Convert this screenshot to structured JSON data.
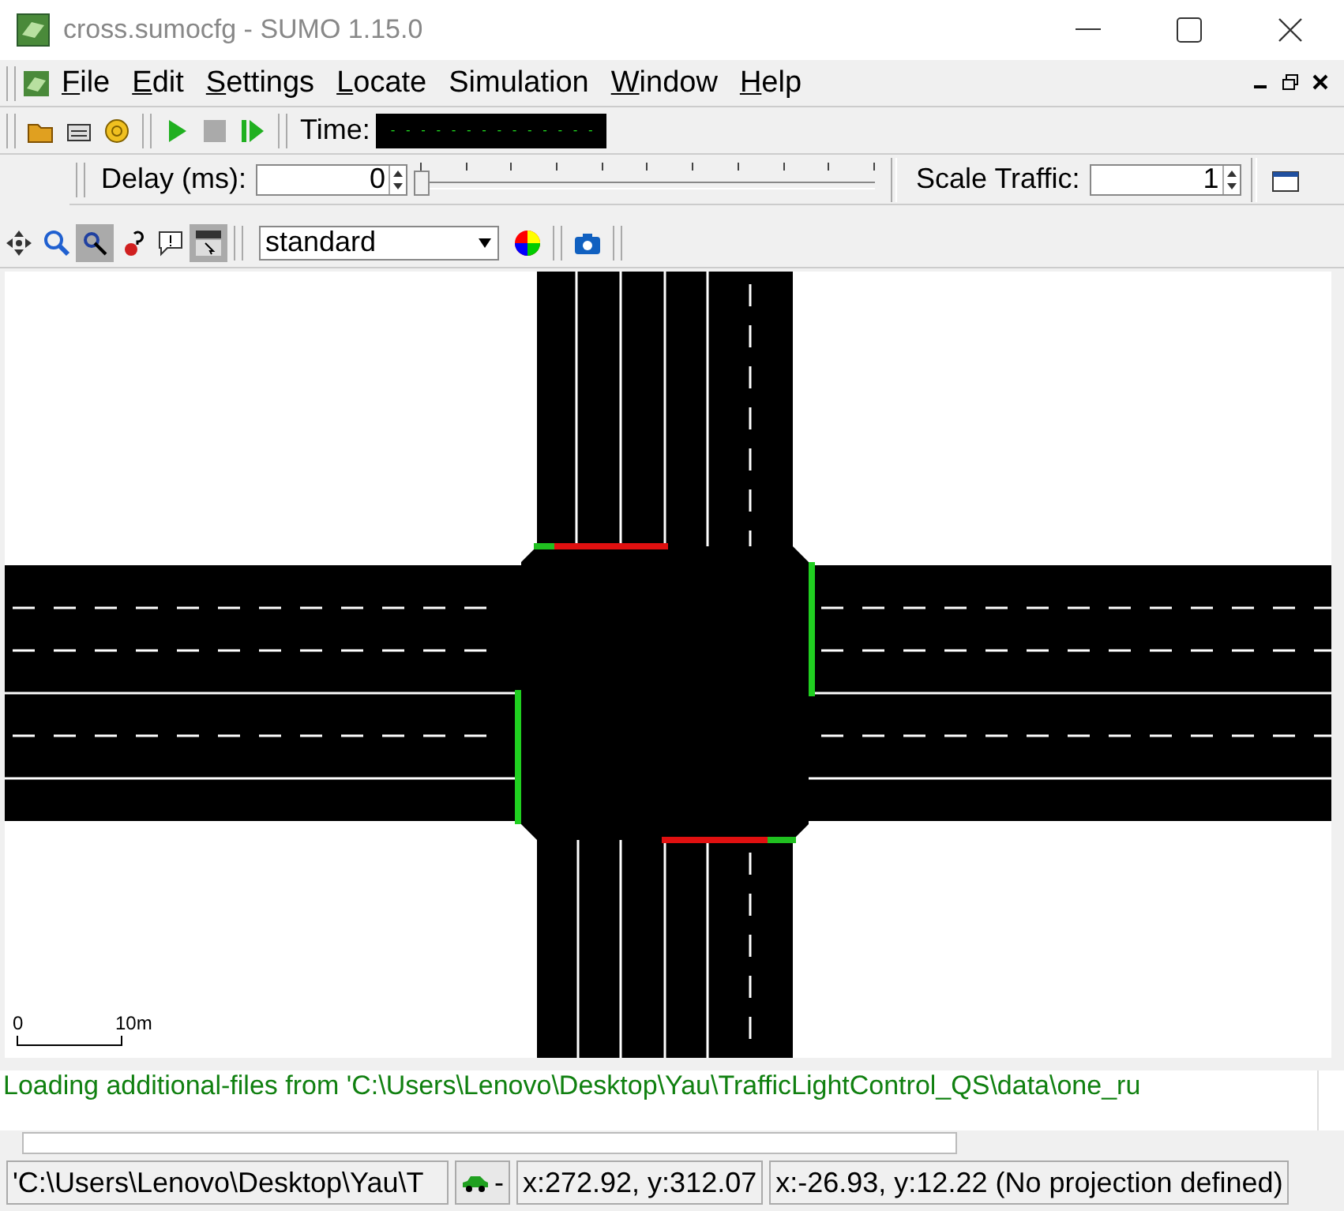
{
  "window": {
    "title": "cross.sumocfg - SUMO 1.15.0"
  },
  "menu": [
    {
      "label": "File",
      "underline_first": true
    },
    {
      "label": "Edit",
      "underline_first": true
    },
    {
      "label": "Settings",
      "underline_first": true
    },
    {
      "label": "Locate",
      "underline_first": true
    },
    {
      "label": "Simulation",
      "underline_first": false
    },
    {
      "label": "Window",
      "underline_first": true
    },
    {
      "label": "Help",
      "underline_first": true
    }
  ],
  "toolbar": {
    "time_label": "Time:",
    "time_display": "- - - - - - - - - - - - - -"
  },
  "delay": {
    "label": "Delay (ms):",
    "value": "0",
    "level": 0
  },
  "scale_traffic": {
    "label": "Scale Traffic:",
    "value": "1"
  },
  "view_toolbar": {
    "scheme": "standard"
  },
  "canvas": {
    "signals": [
      {
        "color": "#20c020"
      },
      {
        "color": "#e01010"
      },
      {
        "color": "#20d020"
      },
      {
        "color": "#20d020"
      },
      {
        "color": "#e01010"
      },
      {
        "color": "#20c020"
      }
    ],
    "scale_start": "0",
    "scale_end": "10m"
  },
  "messages": [
    "Loading additional-files from 'C:\\Users\\Lenovo\\Desktop\\Yau\\TrafficLightControl_QS\\data\\one_ru"
  ],
  "status_bar": {
    "path": "'C:\\Users\\Lenovo\\Desktop\\Yau\\T",
    "vehicle_button": "-",
    "coords": "x:272.92, y:312.07",
    "geo": "x:-26.93, y:12.22 (No projection defined)"
  }
}
